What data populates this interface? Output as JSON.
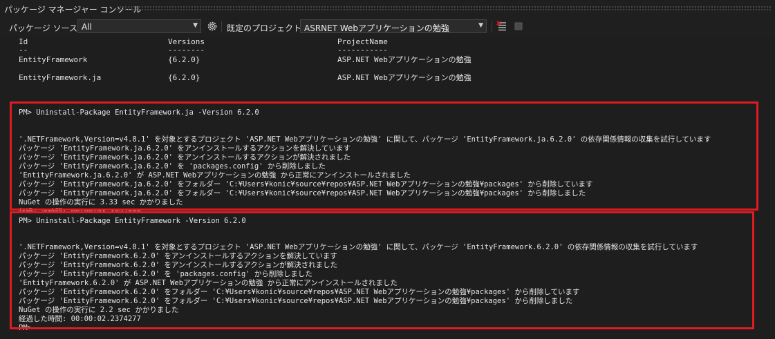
{
  "window": {
    "title": "パッケージ マネージャー コンソール"
  },
  "toolbar": {
    "source_label": "パッケージ ソース(K):",
    "source_value": "All",
    "project_label": "既定のプロジェクト(J):",
    "project_value": "ASRNET Webアプリケーションの勉強",
    "icons": [
      "settings-gear-icon",
      "clear-console-icon",
      "stop-icon"
    ]
  },
  "console": {
    "table": {
      "headers": [
        "Id",
        "Versions",
        "ProjectName"
      ],
      "dividers": [
        "--",
        "--------",
        "-----------"
      ],
      "rows": [
        [
          "EntityFramework",
          "{6.2.0}",
          "ASP.NET Webアプリケーションの勉強"
        ],
        [
          "EntityFramework.ja",
          "{6.2.0}",
          "ASP.NET Webアプリケーションの勉強"
        ]
      ]
    },
    "block1": {
      "command": "PM> Uninstall-Package EntityFramework.ja -Version 6.2.0",
      "lines": [
        "'.NETFramework,Version=v4.8.1' を対象とするプロジェクト 'ASP.NET Webアプリケーションの勉強' に関して、パッケージ 'EntityFramework.ja.6.2.0' の依存関係情報の収集を試行しています",
        "パッケージ 'EntityFramework.ja.6.2.0' をアンインストールするアクションを解決しています",
        "パッケージ 'EntityFramework.ja.6.2.0' をアンインストールするアクションが解決されました",
        "パッケージ 'EntityFramework.ja.6.2.0' を 'packages.config' から削除しました",
        "'EntityFramework.ja.6.2.0' が ASP.NET Webアプリケーションの勉強 から正常にアンインストールされました",
        "パッケージ 'EntityFramework.ja.6.2.0' をフォルダー 'C:¥Users¥konic¥source¥repos¥ASP.NET Webアプリケーションの勉強¥packages' から削除しています",
        "パッケージ 'EntityFramework.ja.6.2.0' をフォルダー 'C:¥Users¥konic¥source¥repos¥ASP.NET Webアプリケーションの勉強¥packages' から削除しました",
        "NuGet の操作の実行に 3.33 sec かかりました"
      ],
      "elapsed_partial": "経過した時間: 00:00:03.3597500"
    },
    "block2": {
      "command": "PM> Uninstall-Package EntityFramework -Version 6.2.0",
      "lines": [
        "'.NETFramework,Version=v4.8.1' を対象とするプロジェクト 'ASP.NET Webアプリケーションの勉強' に関して、パッケージ 'EntityFramework.6.2.0' の依存関係情報の収集を試行しています",
        "パッケージ 'EntityFramework.6.2.0' をアンインストールするアクションを解決しています",
        "パッケージ 'EntityFramework.6.2.0' をアンインストールするアクションが解決されました",
        "パッケージ 'EntityFramework.6.2.0' を 'packages.config' から削除しました",
        "'EntityFramework.6.2.0' が ASP.NET Webアプリケーションの勉強 から正常にアンインストールされました",
        "パッケージ 'EntityFramework.6.2.0' をフォルダー 'C:¥Users¥konic¥source¥repos¥ASP.NET Webアプリケーションの勉強¥packages' から削除しています",
        "パッケージ 'EntityFramework.6.2.0' をフォルダー 'C:¥Users¥konic¥source¥repos¥ASP.NET Webアプリケーションの勉強¥packages' から削除しました",
        "NuGet の操作の実行に 2.2 sec かかりました",
        "経過した時間: 00:00:02.2374277"
      ],
      "prompt_partial": "PM>"
    }
  },
  "colors": {
    "highlight": "#e01c22",
    "background": "#1e1e1e",
    "text": "#e6e6e6"
  }
}
